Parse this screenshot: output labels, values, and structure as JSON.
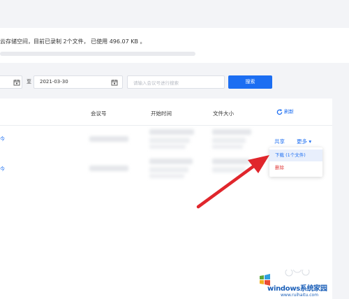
{
  "storage": {
    "text": "云存储空间，目前已录制 2个文件， 已使用 496.07 KB 。"
  },
  "filters": {
    "start_date": "",
    "to_label": "至",
    "end_date": "2021-03-30",
    "search_placeholder": "请输入会议号进行搜索",
    "search_button": "搜索"
  },
  "table": {
    "headers": {
      "meeting_id": "会议号",
      "start_time": "开始时间",
      "file_size": "文件大小",
      "refresh": "刷新"
    },
    "rows": [
      {
        "name_fragment": "今"
      },
      {
        "name_fragment": "今"
      }
    ]
  },
  "actions": {
    "share": "共享",
    "more": "更多 ▾"
  },
  "dropdown": {
    "download": "下载 (1个文件)",
    "delete": "删除"
  },
  "watermark": {
    "brand": "windows系统家园",
    "url": "www.ruihaitu.com"
  },
  "colors": {
    "accent": "#1c6ef2",
    "danger": "#e03a3a",
    "arrow": "#e0262c"
  }
}
